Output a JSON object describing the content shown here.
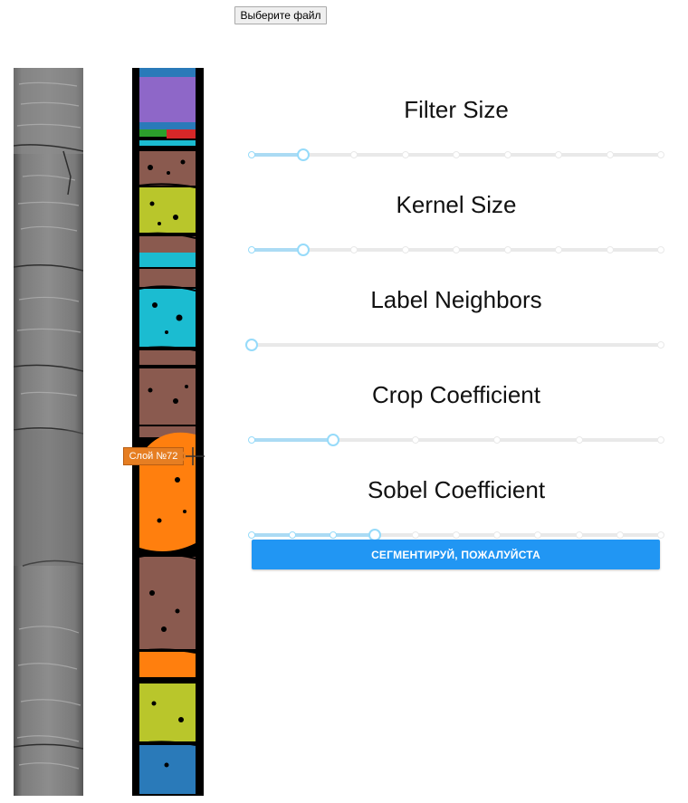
{
  "file_button": {
    "label": "Выберите файл"
  },
  "tooltip": {
    "label": "Слой №72"
  },
  "sliders": [
    {
      "title": "Filter Size",
      "steps": 8,
      "value_fraction": 0.125
    },
    {
      "title": "Kernel Size",
      "steps": 8,
      "value_fraction": 0.125
    },
    {
      "title": "Label Neighbors",
      "steps": 1,
      "value_fraction": 0.0
    },
    {
      "title": "Crop Coefficient",
      "steps": 5,
      "value_fraction": 0.2
    },
    {
      "title": "Sobel Coefficient",
      "steps": 10,
      "value_fraction": 0.3
    }
  ],
  "segment_button": {
    "label": "СЕГМЕНТИРУЙ, ПОЖАЛУЙСТА"
  },
  "colors": {
    "accent": "#2196f3",
    "slider_track": "#abdbf4",
    "tooltip": "#e67e22",
    "layer_purple": "#8e67c8",
    "layer_brown": "#8a5a4f",
    "layer_olive": "#b9c62b",
    "layer_cyan": "#1bbcd1",
    "layer_orange": "#ff7f0e",
    "layer_blue": "#2a7ab9",
    "layer_red": "#d62728",
    "layer_green": "#2ca02c"
  }
}
